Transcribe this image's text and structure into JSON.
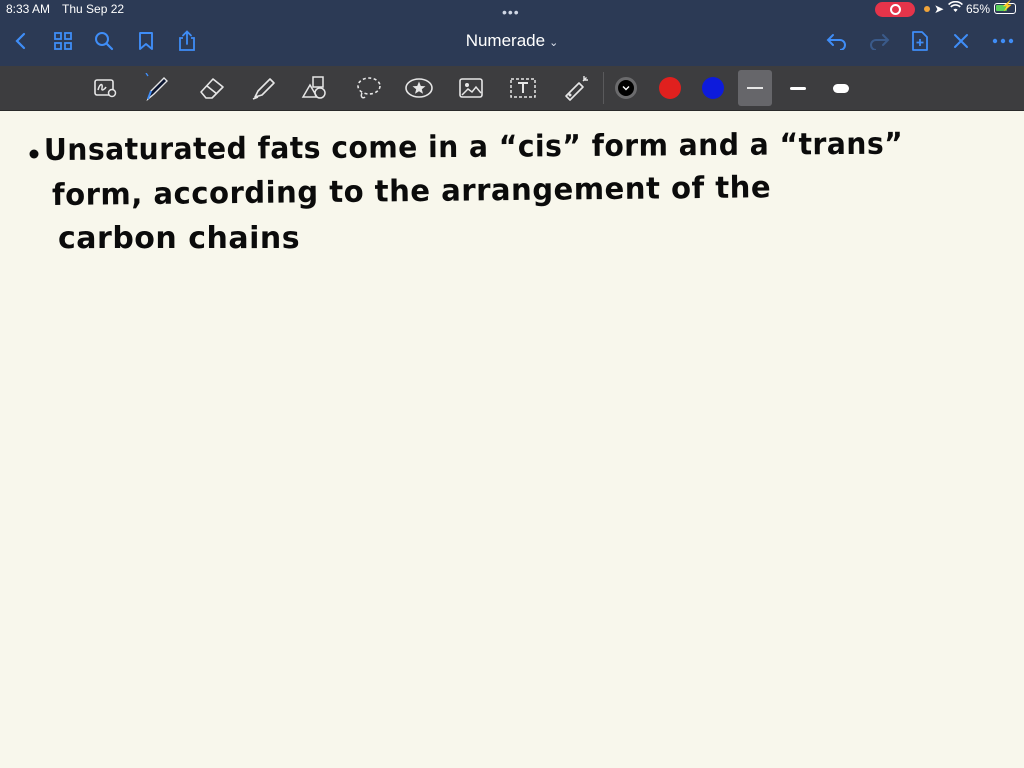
{
  "status_bar": {
    "time": "8:33 AM",
    "date": "Thu Sep 22",
    "multitask_dots": "•••",
    "location_icon": "➤",
    "wifi_icon": "wifi-icon",
    "battery_percent": "65%",
    "battery_level": 0.65,
    "recording_color": "#e5344a"
  },
  "nav": {
    "document_title": "Numerade",
    "title_chevron": "⌄"
  },
  "toolbar": {
    "colors": [
      "#000000",
      "#e0201e",
      "#0d1bdc"
    ],
    "selected_color_index": 0,
    "stroke_widths_selected_index": 0
  },
  "note": {
    "lines": [
      "Unsaturated fats come in a “cis” form and a “trans”",
      "form, according to the arrangement of the",
      "carbon chains"
    ]
  }
}
